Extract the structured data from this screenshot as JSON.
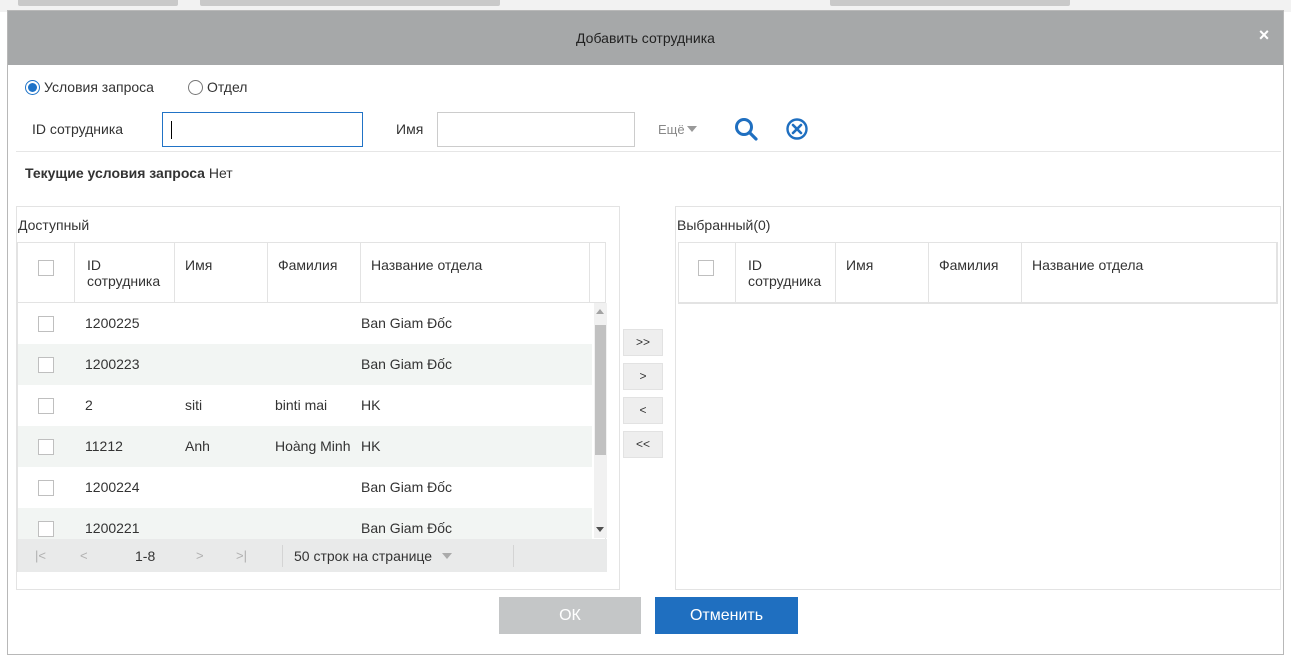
{
  "dialog": {
    "title": "Добавить сотрудника",
    "close_glyph": "×"
  },
  "query_mode": {
    "options": [
      "Условия запроса",
      "Отдел"
    ],
    "selected": "Условия запроса"
  },
  "filters": {
    "employee_id_label": "ID сотрудника",
    "employee_id_value": "",
    "name_label": "Имя",
    "name_value": "",
    "more_label": "Ещё",
    "search_icon": "search-icon",
    "clear_icon": "clear-icon"
  },
  "current_conditions": {
    "label": "Текущие условия запроса",
    "value": "Нет"
  },
  "available": {
    "title": "Доступный",
    "columns": [
      "ID сотрудника",
      "Имя",
      "Фамилия",
      "Название отдела"
    ],
    "rows": [
      {
        "id": "1200225",
        "first": "",
        "last": "",
        "dept": "Ban Giam Đốc"
      },
      {
        "id": "1200223",
        "first": "",
        "last": "",
        "dept": "Ban Giam Đốc"
      },
      {
        "id": "2",
        "first": "siti",
        "last": "binti mai",
        "dept": "HK"
      },
      {
        "id": "11212",
        "first": "Anh",
        "last": "Hoàng Minh",
        "dept": "HK"
      },
      {
        "id": "1200224",
        "first": "",
        "last": "",
        "dept": "Ban Giam Đốc"
      },
      {
        "id": "1200221",
        "first": "",
        "last": "",
        "dept": "Ban Giam Đốc"
      }
    ],
    "pager": {
      "first": "|<",
      "prev": "<",
      "range": "1-8",
      "next": ">",
      "last": ">|",
      "per_page": "50 строк на странице"
    }
  },
  "transfer": {
    "all_right": ">>",
    "right": ">",
    "left": "<",
    "all_left": "<<"
  },
  "selected": {
    "title": "Выбранный(0)",
    "columns": [
      "ID сотрудника",
      "Имя",
      "Фамилия",
      "Название отдела"
    ]
  },
  "buttons": {
    "ok": "ОК",
    "cancel": "Отменить"
  },
  "colors": {
    "titlebar": "#a6a8a9",
    "accent": "#1f6fc0",
    "disabled": "#c4c6c7",
    "row_alt": "#f2f5f3"
  }
}
